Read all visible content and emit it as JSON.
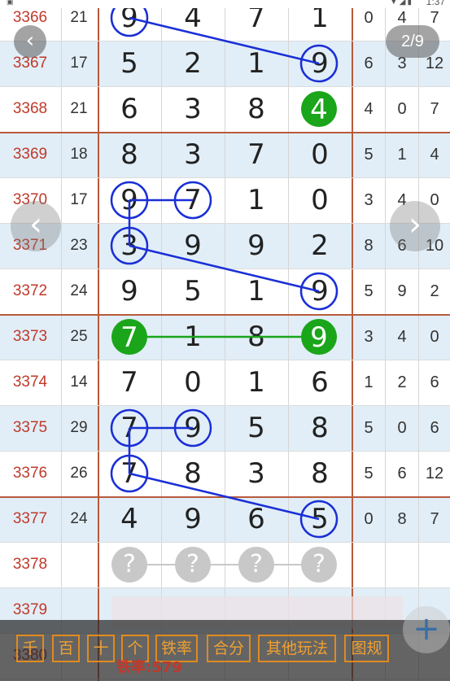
{
  "status": {
    "time": "1:37"
  },
  "nav": {
    "page_indicator": "2/9",
    "back_icon": "chevron-left",
    "prev_icon": "chevron-left",
    "next_icon": "chevron-right"
  },
  "rows": [
    {
      "issue": "3366",
      "sum": "21",
      "digits": [
        "9",
        "4",
        "7",
        "1"
      ],
      "extra": [
        "0",
        "4",
        "7"
      ]
    },
    {
      "issue": "3367",
      "sum": "17",
      "digits": [
        "5",
        "2",
        "1",
        "9"
      ],
      "extra": [
        "6",
        "3",
        "12"
      ]
    },
    {
      "issue": "3368",
      "sum": "21",
      "digits": [
        "6",
        "3",
        "8",
        "4"
      ],
      "extra": [
        "4",
        "0",
        "7"
      ]
    },
    {
      "issue": "3369",
      "sum": "18",
      "digits": [
        "8",
        "3",
        "7",
        "0"
      ],
      "extra": [
        "5",
        "1",
        "4"
      ]
    },
    {
      "issue": "3370",
      "sum": "17",
      "digits": [
        "9",
        "7",
        "1",
        "0"
      ],
      "extra": [
        "3",
        "4",
        "0"
      ]
    },
    {
      "issue": "3371",
      "sum": "23",
      "digits": [
        "3",
        "9",
        "9",
        "2"
      ],
      "extra": [
        "8",
        "6",
        "10"
      ]
    },
    {
      "issue": "3372",
      "sum": "24",
      "digits": [
        "9",
        "5",
        "1",
        "9"
      ],
      "extra": [
        "5",
        "9",
        "2"
      ]
    },
    {
      "issue": "3373",
      "sum": "25",
      "digits": [
        "7",
        "1",
        "8",
        "9"
      ],
      "extra": [
        "3",
        "4",
        "0"
      ]
    },
    {
      "issue": "3374",
      "sum": "14",
      "digits": [
        "7",
        "0",
        "1",
        "6"
      ],
      "extra": [
        "1",
        "2",
        "6"
      ]
    },
    {
      "issue": "3375",
      "sum": "29",
      "digits": [
        "7",
        "9",
        "5",
        "8"
      ],
      "extra": [
        "5",
        "0",
        "6"
      ]
    },
    {
      "issue": "3376",
      "sum": "26",
      "digits": [
        "7",
        "8",
        "3",
        "8"
      ],
      "extra": [
        "5",
        "6",
        "12"
      ]
    },
    {
      "issue": "3377",
      "sum": "24",
      "digits": [
        "4",
        "9",
        "6",
        "5"
      ],
      "extra": [
        "0",
        "8",
        "7"
      ]
    },
    {
      "issue": "3378",
      "sum": "",
      "digits": [
        "?",
        "?",
        "?",
        "?"
      ],
      "extra": [
        "",
        "",
        ""
      ]
    },
    {
      "issue": "3379",
      "sum": "",
      "digits": [
        "",
        "",
        "",
        ""
      ],
      "extra": [
        "",
        "",
        ""
      ]
    },
    {
      "issue": "3380",
      "sum": "",
      "digits": [
        "",
        "",
        "",
        ""
      ],
      "extra": [
        "",
        "",
        ""
      ]
    }
  ],
  "highlights": {
    "blue_circles": [
      [
        0,
        0
      ],
      [
        1,
        3
      ],
      [
        4,
        0
      ],
      [
        4,
        1
      ],
      [
        5,
        0
      ],
      [
        6,
        3
      ],
      [
        9,
        0
      ],
      [
        9,
        1
      ],
      [
        10,
        0
      ],
      [
        11,
        3
      ]
    ],
    "green_filled": [
      [
        2,
        3
      ],
      [
        7,
        0
      ],
      [
        7,
        3
      ]
    ]
  },
  "toolbar": {
    "buttons": [
      "千",
      "百",
      "十",
      "个",
      "铁率",
      "合分",
      "其他玩法",
      "图规"
    ],
    "rate_text": "铁率:579"
  },
  "fab_icon": "plus",
  "colors": {
    "issue": "#c0392b",
    "blue_line": "#1a2fd6",
    "green": "#1aa51a",
    "orange": "#e08a1e",
    "row_alt": "#e1eef7"
  }
}
